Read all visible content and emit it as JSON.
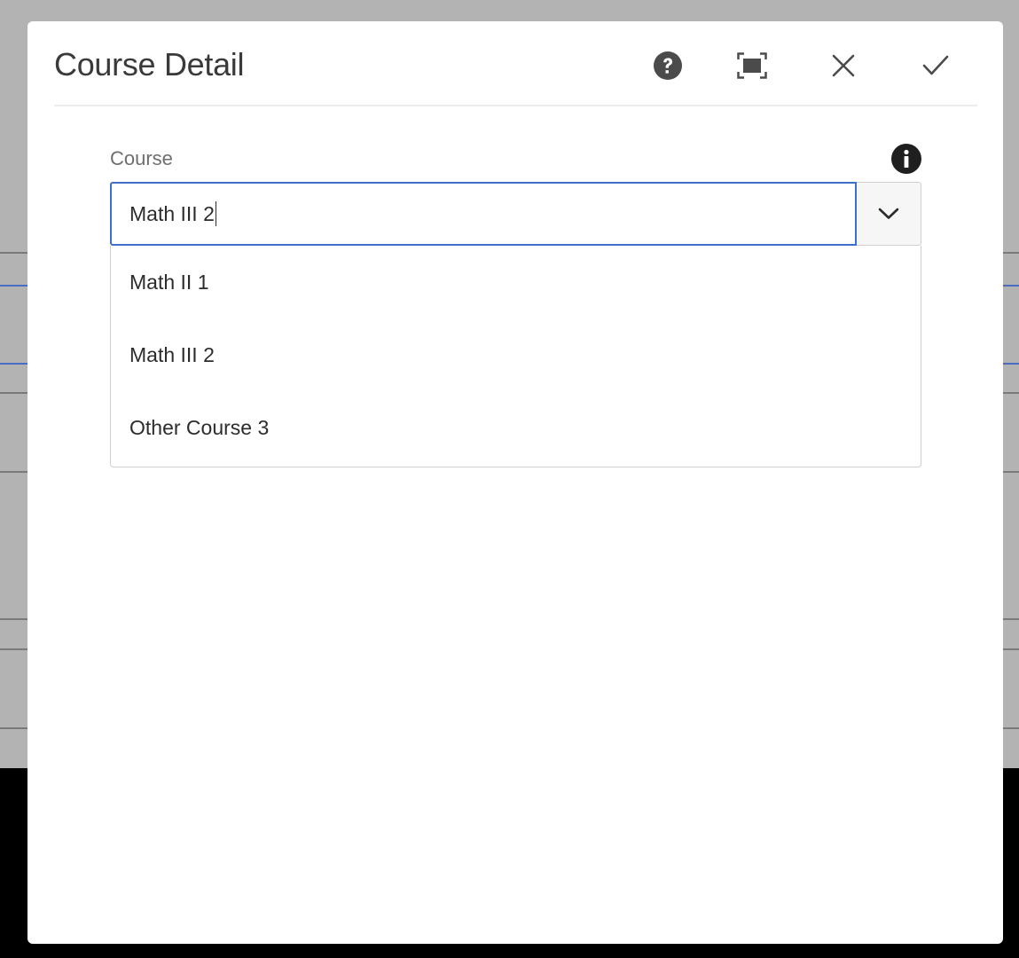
{
  "dialog": {
    "title": "Course Detail",
    "header_icons": [
      "help-icon",
      "fullscreen-icon",
      "close-icon",
      "check-icon"
    ]
  },
  "field": {
    "label": "Course",
    "value": "Math III 2",
    "info_icon": "info-icon",
    "toggle_icon": "chevron-down-icon"
  },
  "options": [
    {
      "label": "Math II 1"
    },
    {
      "label": "Math III 2"
    },
    {
      "label": "Other Course 3"
    }
  ],
  "colors": {
    "focus_border": "#3d6fd1",
    "backdrop": "#b3b3b3",
    "icon": "#4b4b4b"
  }
}
